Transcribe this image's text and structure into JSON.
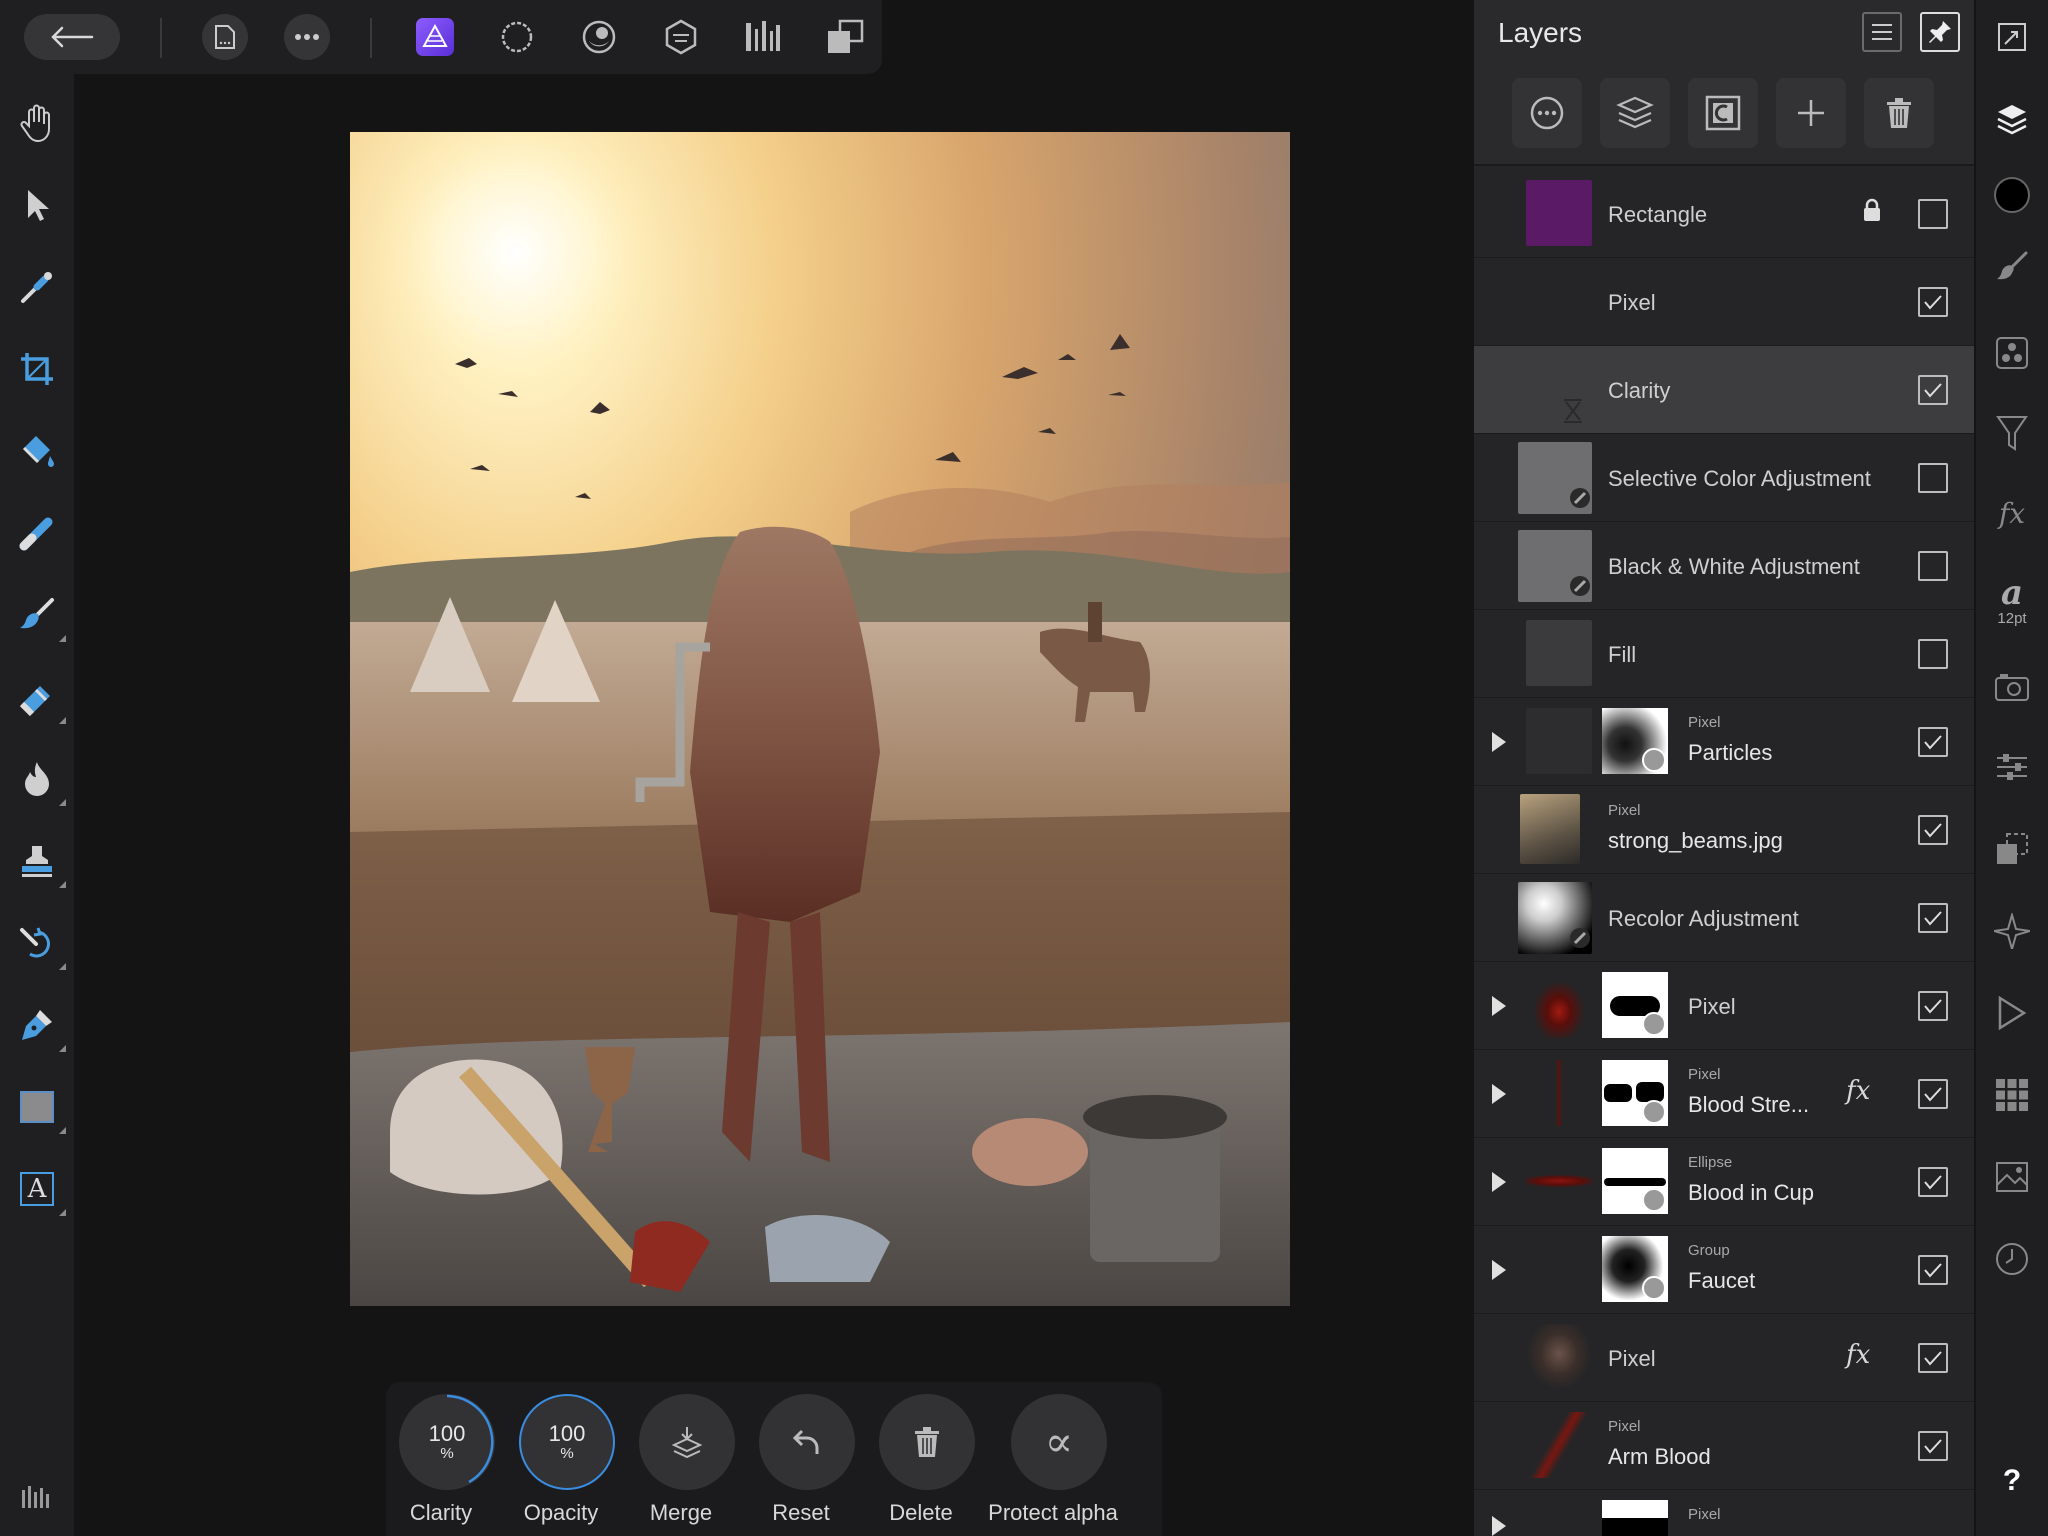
{
  "layers_panel": {
    "title": "Layers",
    "rows": [
      {
        "name": "Rectangle",
        "kind": "",
        "checked": false,
        "locked": true,
        "fx": false
      },
      {
        "name": "Pixel",
        "kind": "",
        "checked": true,
        "fx": false
      },
      {
        "name": "Clarity",
        "kind": "",
        "checked": true,
        "selected": true,
        "fx": false
      },
      {
        "name": "Selective Color Adjustment",
        "kind": "",
        "checked": false,
        "fx": false
      },
      {
        "name": "Black & White Adjustment",
        "kind": "",
        "checked": false,
        "fx": false
      },
      {
        "name": "Fill",
        "kind": "",
        "checked": false,
        "fx": false
      },
      {
        "name": "Particles",
        "kind": "Pixel",
        "checked": true,
        "fx": false
      },
      {
        "name": "strong_beams.jpg",
        "kind": "Pixel",
        "checked": true,
        "fx": false
      },
      {
        "name": "Recolor Adjustment",
        "kind": "",
        "checked": true,
        "fx": false
      },
      {
        "name": "Pixel",
        "kind": "",
        "checked": true,
        "fx": false
      },
      {
        "name": "Blood Stre...",
        "kind": "Pixel",
        "checked": true,
        "fx": true
      },
      {
        "name": "Blood in Cup",
        "kind": "Ellipse",
        "checked": true,
        "fx": false
      },
      {
        "name": "Faucet",
        "kind": "Group",
        "checked": true,
        "fx": false
      },
      {
        "name": "Pixel",
        "kind": "",
        "checked": true,
        "fx": true
      },
      {
        "name": "Arm Blood",
        "kind": "Pixel",
        "checked": true,
        "fx": false
      },
      {
        "name": "",
        "kind": "Pixel",
        "checked": true,
        "fx": false
      }
    ],
    "fx_label": "fx"
  },
  "context_bar": {
    "clarity": {
      "value": "100",
      "unit": "%",
      "label": "Clarity"
    },
    "opacity": {
      "value": "100",
      "unit": "%",
      "label": "Opacity"
    },
    "merge_label": "Merge",
    "reset_label": "Reset",
    "delete_label": "Delete",
    "protect_alpha_label": "Protect alpha",
    "protect_alpha_glyph": "∝"
  },
  "right_strip": {
    "text_style_glyph": "a",
    "font_size": "12pt",
    "fx_glyph": "fx",
    "help_glyph": "?"
  },
  "colors": {
    "accent": "#6b3cf0",
    "primary_color": "#000000",
    "rectangle_fill": "#5a1a66",
    "selected_row": "#3d3d3f"
  }
}
